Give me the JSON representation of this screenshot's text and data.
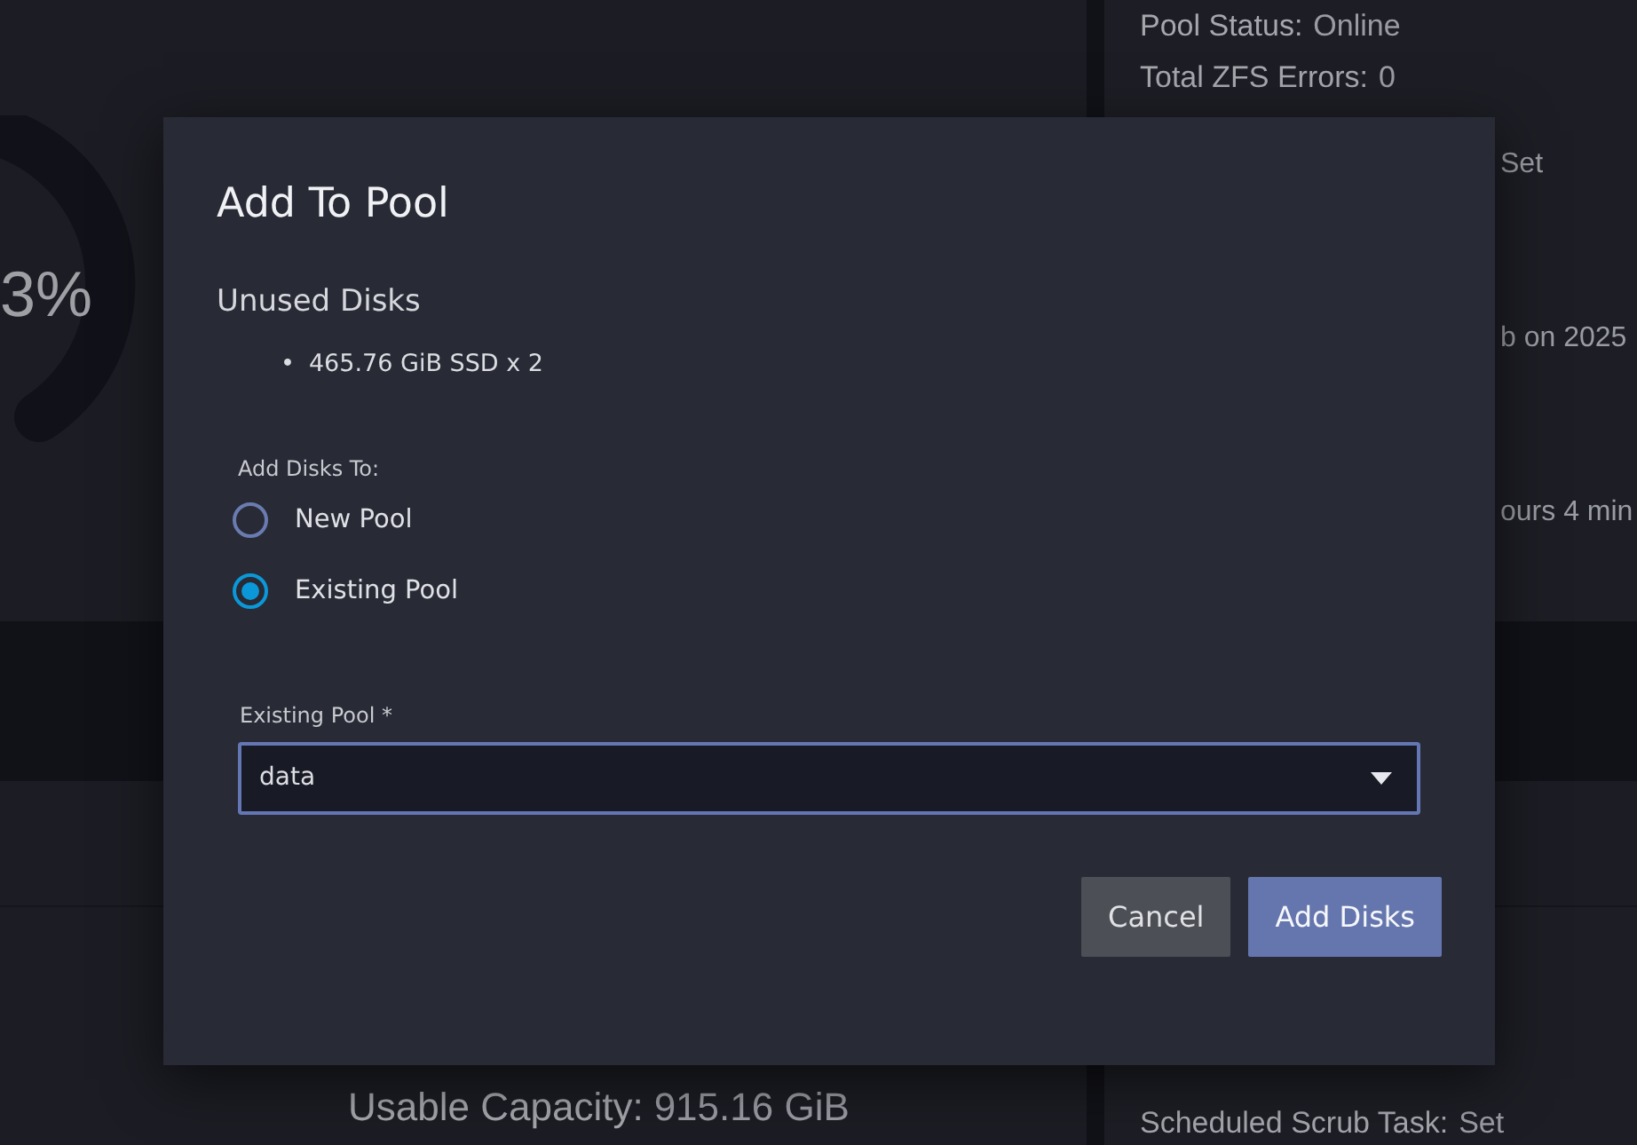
{
  "background": {
    "usage_card": {
      "percent": "3%"
    },
    "status_card": {
      "lines": [
        {
          "label": "Pool Status:",
          "value": "Online"
        },
        {
          "label": "Total ZFS Errors:",
          "value": "0"
        }
      ],
      "fragments": [
        "Set",
        "b on 2025",
        "ours 4 min"
      ]
    },
    "capacity_card": {
      "label": "Usable Capacity:",
      "value": "915.16 GiB"
    },
    "scrub_line": {
      "label": "Scheduled Scrub Task:",
      "value": "Set"
    }
  },
  "dialog": {
    "title": "Add To Pool",
    "section_title": "Unused Disks",
    "bullet": "•",
    "disks": [
      "465.76 GiB SSD x 2"
    ],
    "radio_group_label": "Add Disks To:",
    "options": [
      {
        "label": "New Pool",
        "selected": false
      },
      {
        "label": "Existing Pool",
        "selected": true
      }
    ],
    "select": {
      "label": "Existing Pool",
      "required_mark": "*",
      "value": "data"
    },
    "buttons": [
      {
        "label": "Cancel",
        "kind": "secondary"
      },
      {
        "label": "Add Disks",
        "kind": "primary"
      }
    ]
  }
}
